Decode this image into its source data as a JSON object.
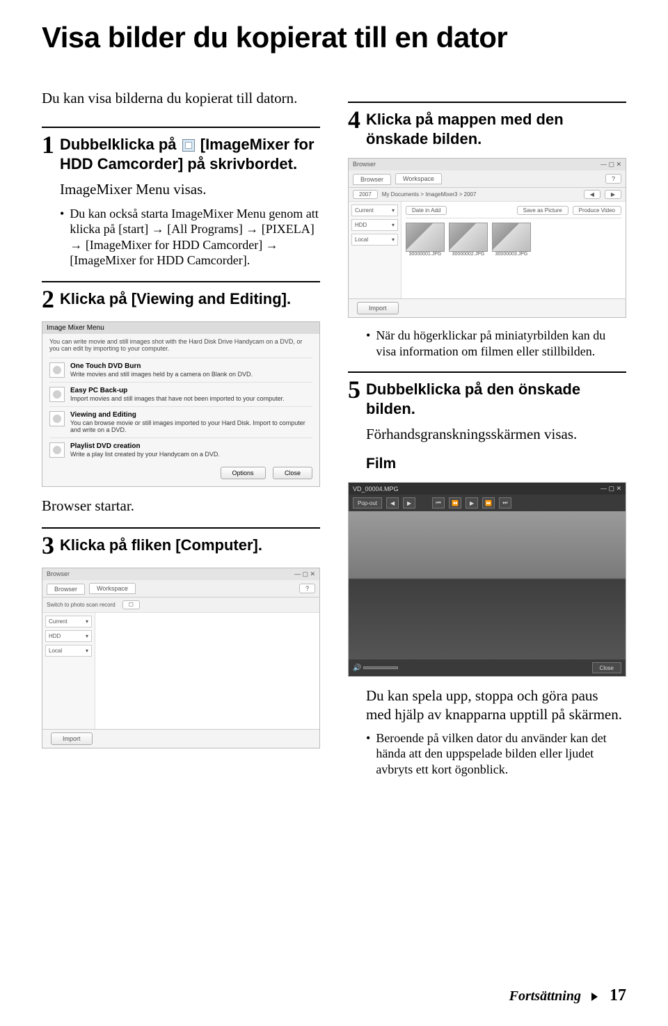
{
  "title": "Visa bilder du kopierat till en dator",
  "intro": "Du kan visa bilderna du kopierat till datorn.",
  "steps": {
    "s1": {
      "num": "1",
      "text_a": "Dubbelklicka på ",
      "text_b": " [ImageMixer for HDD Camcorder] på skrivbordet.",
      "sub": "ImageMixer Menu visas.",
      "bullet": "Du kan också starta ImageMixer Menu genom att klicka på [start] → [All Programs] → [PIXELA] → [ImageMixer for HDD Camcorder] → [ImageMixer for HDD Camcorder]."
    },
    "s2": {
      "num": "2",
      "text": "Klicka på [Viewing and Editing]."
    },
    "s3": {
      "num": "3",
      "text": "Klicka på fliken [Computer]."
    },
    "s4": {
      "num": "4",
      "text": "Klicka på mappen med den önskade bilden.",
      "bullet": "När du högerklickar på miniatyrbilden kan du visa information om filmen eller stillbilden."
    },
    "s5": {
      "num": "5",
      "text": "Dubbelklicka på den önskade bilden.",
      "sub": "Förhandsgranskningsskärmen visas.",
      "film": "Film",
      "sub2": "Du kan spela upp, stoppa och göra paus med hjälp av knapparna upptill på skärmen.",
      "bullet": "Beroende på vilken dator du använder kan det hända att den uppspelade bilden eller ljudet avbryts ett kort ögonblick."
    }
  },
  "browser_start": "Browser startar.",
  "fig_menu": {
    "title": "Image Mixer Menu",
    "desc": "You can write movie and still images shot with the Hard Disk Drive Handycam on a DVD, or you can edit by importing to your computer.",
    "items": [
      {
        "h": "One Touch DVD Burn",
        "d": "Write movies and still images held by a camera on Blank on DVD."
      },
      {
        "h": "Easy PC Back-up",
        "d": "Import movies and still images that have not been imported to your computer."
      },
      {
        "h": "Viewing and Editing",
        "d": "You can browse movie or still images imported to your Hard Disk. Import to computer and write on a DVD."
      },
      {
        "h": "Playlist DVD creation",
        "d": "Write a play list created by your Handycam on a DVD."
      }
    ],
    "btn1": "Options",
    "btn2": "Close"
  },
  "fig_browser1": {
    "title": "Browser",
    "tab1": "Browser",
    "tab2": "Workspace",
    "toolbar_text": "Switch to photo scan record",
    "side": [
      "Current",
      "HDD",
      "Local"
    ],
    "bottom_btn": "Import"
  },
  "fig_browser2": {
    "title": "Browser",
    "tab1": "Browser",
    "tab2": "Workspace",
    "path": "My Documents > ImageMixer3 > 2007",
    "date": "2007",
    "btn_date": "Date in Add",
    "btn_save": "Save as Picture",
    "btn_produce": "Produce Video",
    "side": [
      "Current",
      "HDD",
      "Local"
    ],
    "thumbs": [
      "30000001.JPG",
      "30000002.JPG",
      "30000003.JPG"
    ],
    "bottom_btn": "Import"
  },
  "fig_video": {
    "title": "VD_00004.MPG",
    "popout": "Pop-out",
    "close": "Close"
  },
  "footer": {
    "text": "Fortsättning",
    "page": "17"
  }
}
